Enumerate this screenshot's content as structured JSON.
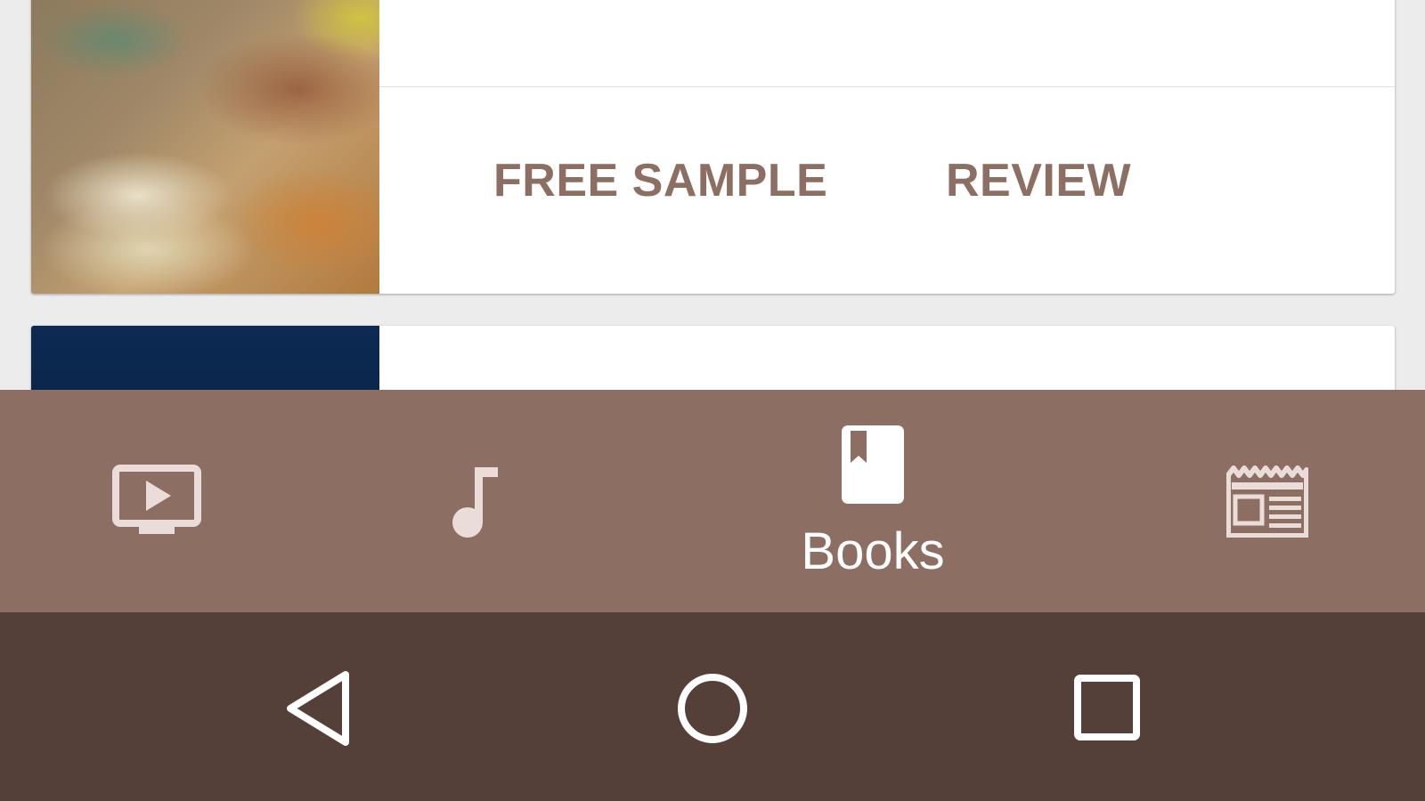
{
  "card": {
    "actions": {
      "free_sample_label": "FREE SAMPLE",
      "review_label": "REVIEW"
    }
  },
  "bottom_nav": {
    "items": [
      {
        "icon": "movies-tv-icon",
        "label": "",
        "selected": false
      },
      {
        "icon": "music-note-icon",
        "label": "",
        "selected": false
      },
      {
        "icon": "book-icon",
        "label": "Books",
        "selected": true
      },
      {
        "icon": "newsstand-icon",
        "label": "",
        "selected": false
      }
    ]
  },
  "system_nav": {
    "buttons": [
      "back-icon",
      "home-icon",
      "recent-apps-icon"
    ]
  },
  "colors": {
    "accent": "#8d6e63",
    "bottom_nav_bg": "#8d6e63",
    "system_bar_bg": "#544039",
    "icon_inactive": "#eaddd9",
    "icon_active": "#ffffff",
    "card_bg": "#ffffff",
    "screen_bg": "#ececec"
  }
}
